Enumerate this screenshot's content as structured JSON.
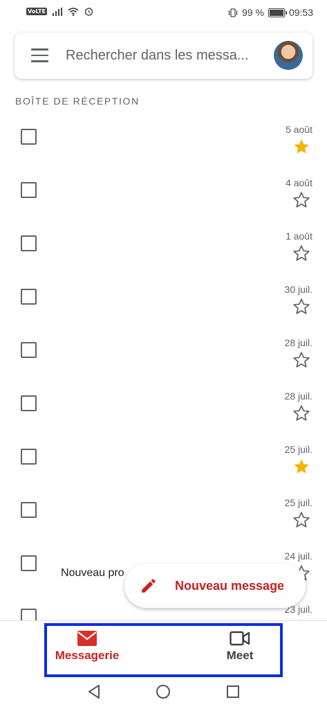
{
  "status_bar": {
    "volte": "VoLTE",
    "battery_percent": "99 %",
    "battery_level": 0.99,
    "time": "09:53"
  },
  "search": {
    "placeholder": "Rechercher dans les messa..."
  },
  "inbox": {
    "section_title": "BOÎTE DE RÉCEPTION",
    "rows": [
      {
        "date": "5 août",
        "starred": true
      },
      {
        "date": "4 août",
        "starred": false
      },
      {
        "date": "1 août",
        "starred": false
      },
      {
        "date": "30 juil.",
        "starred": false
      },
      {
        "date": "28 juil.",
        "starred": false
      },
      {
        "date": "28 juil.",
        "starred": false
      },
      {
        "date": "25 juil.",
        "starred": true
      },
      {
        "date": "25 juil.",
        "starred": false
      },
      {
        "date": "24 juil.",
        "starred": false,
        "snippet": "Nouveau pro"
      },
      {
        "date": "23 juil.",
        "starred": true
      }
    ]
  },
  "fab": {
    "label": "Nouveau message"
  },
  "bottom_nav": {
    "mail_label": "Messagerie",
    "meet_label": "Meet"
  },
  "colors": {
    "accent": "#c5221f",
    "star": "#f4b400",
    "highlight": "#0a2fe0"
  },
  "icons": {
    "menu": "menu-icon",
    "mail": "mail-icon",
    "meet": "video-camera-icon",
    "compose": "pencil-icon",
    "star": "star-icon"
  }
}
